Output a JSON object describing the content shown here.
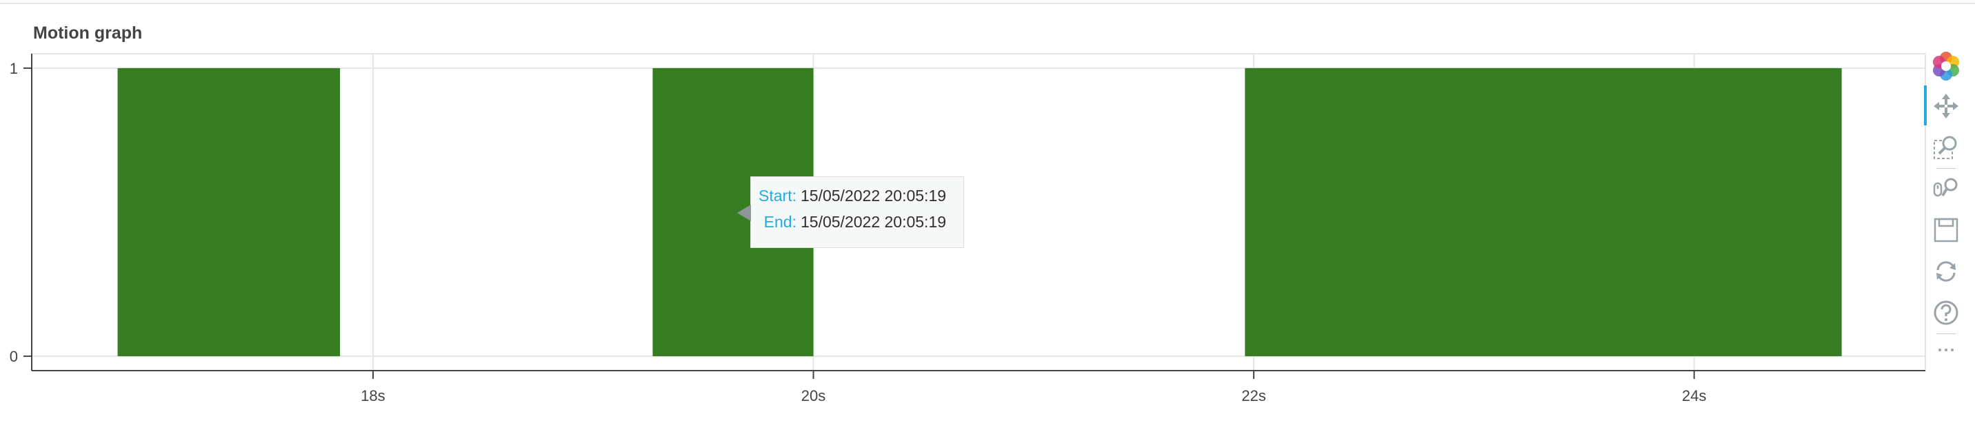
{
  "title": "Motion graph",
  "tooltip": {
    "rows": [
      {
        "label": "Start:",
        "value": "15/05/2022 20:05:19"
      },
      {
        "label": "End:",
        "value": "15/05/2022 20:05:19"
      }
    ]
  },
  "toolbar": {
    "tools": [
      {
        "icon": "bokeh-logo-icon",
        "interactable": false
      },
      {
        "icon": "pan-icon",
        "interactable": true,
        "active": true
      },
      {
        "icon": "box-zoom-icon",
        "interactable": true
      },
      {
        "icon": "wheel-zoom-icon",
        "interactable": true
      },
      {
        "icon": "save-icon",
        "interactable": true
      },
      {
        "icon": "reset-icon",
        "interactable": true
      },
      {
        "icon": "help-icon",
        "interactable": true
      },
      {
        "icon": "more-icon",
        "interactable": true
      }
    ]
  },
  "colors": {
    "bar": "#377e22",
    "grid": "#e5e5e5",
    "axis": "#444444",
    "tooltip_label": "#26aae1"
  },
  "chart_data": {
    "type": "bar",
    "title": "Motion graph",
    "xlabel": "",
    "ylabel": "",
    "x_unit": "s",
    "xlim": [
      16.45,
      25.05
    ],
    "ylim": [
      -0.05,
      1.05
    ],
    "x_ticks": [
      18,
      20,
      22,
      24
    ],
    "x_tick_labels": [
      "18s",
      "20s",
      "22s",
      "24s"
    ],
    "y_ticks": [
      0,
      1
    ],
    "y_tick_labels": [
      "0",
      "1"
    ],
    "grid": true,
    "legend": "none",
    "bars": [
      {
        "start": 16.84,
        "end": 17.85,
        "value": 1
      },
      {
        "start": 19.27,
        "end": 20.0,
        "value": 1
      },
      {
        "start": 21.96,
        "end": 24.67,
        "value": 1
      }
    ]
  }
}
